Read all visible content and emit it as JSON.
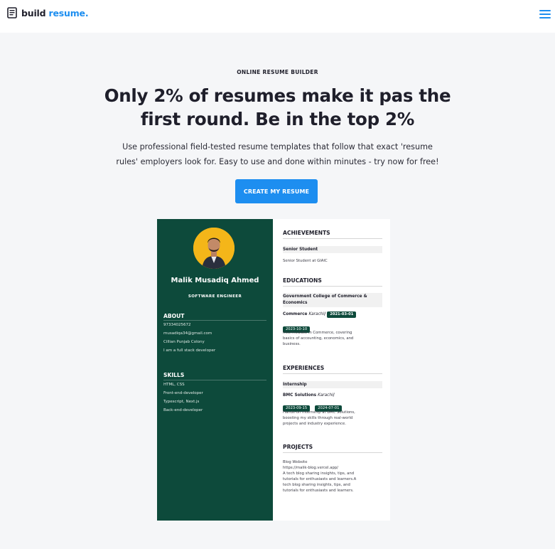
{
  "nav": {
    "brand_main": "build",
    "brand_accent": "resume.",
    "menu_icon": "hamburger-menu-icon",
    "brand_icon": "document-icon"
  },
  "hero": {
    "kicker": "ONLINE RESUME BUILDER",
    "title_line1": "Only 2% of resumes make it pas the",
    "title_line2": "first round. Be in the top 2%",
    "subtitle_line1": "Use professional field-tested resume templates that follow that exact 'resume",
    "subtitle_line2": "rules' employers look for. Easy to use and done within minutes - try now for free!",
    "cta_label": "CREATE MY RESUME"
  },
  "colors": {
    "accent": "#1d8ef0",
    "resume_sidebar": "#0d4a3b",
    "avatar_bg": "#f4b619",
    "page_bg": "#f5f6f8"
  },
  "resume": {
    "name": "Malik Musadiq Ahmed",
    "role": "SOFTWARE ENGINEER",
    "about": {
      "heading": "ABOUT",
      "phone": "97334025672",
      "email": "musadiqa34@gmail.com",
      "location": "Cillian Punjab Colony",
      "bio": "I am a full stack developer"
    },
    "skills": {
      "heading": "SKILLS",
      "items": [
        "HTML, CSS",
        "Front-end-developer",
        "Typescript, Next.js",
        "Back-end-developer"
      ]
    },
    "achievements": {
      "heading": "ACHIEVEMENTS",
      "title": "Senior Student",
      "text": "Senior Student at GIAIC"
    },
    "educations": {
      "heading": "EDUCATIONS",
      "title_line1": "Government College of Commerce &",
      "title_line2": "Economics",
      "degree": "Commerce",
      "city": "Karachi",
      "start": "2021-03-01",
      "end": "2023-10-10",
      "desc_line1": "Intermediate in Commerce, covering",
      "desc_line2": "basics of accounting, economics, and",
      "desc_line3": "business."
    },
    "experiences": {
      "heading": "EXPERIENCES",
      "title": "Internship",
      "company": "BMC Solutions",
      "city": "Karachi",
      "start": "2023-09-15",
      "end": "2024-07-01",
      "desc_line1": "Hands-on internship at BMC Solutions,",
      "desc_line2": "boosting my skills through real-world",
      "desc_line3": "projects and industry experience."
    },
    "projects": {
      "heading": "PROJECTS",
      "name": "Blog Website",
      "url": "https://malik-blog.vercel.app/",
      "desc_line1": "A tech blog sharing insights, tips, and",
      "desc_line2": "tutorials for enthusiasts and learners.A",
      "desc_line3": "tech blog sharing insights, tips, and",
      "desc_line4": "tutorials for enthusiasts and learners."
    }
  }
}
